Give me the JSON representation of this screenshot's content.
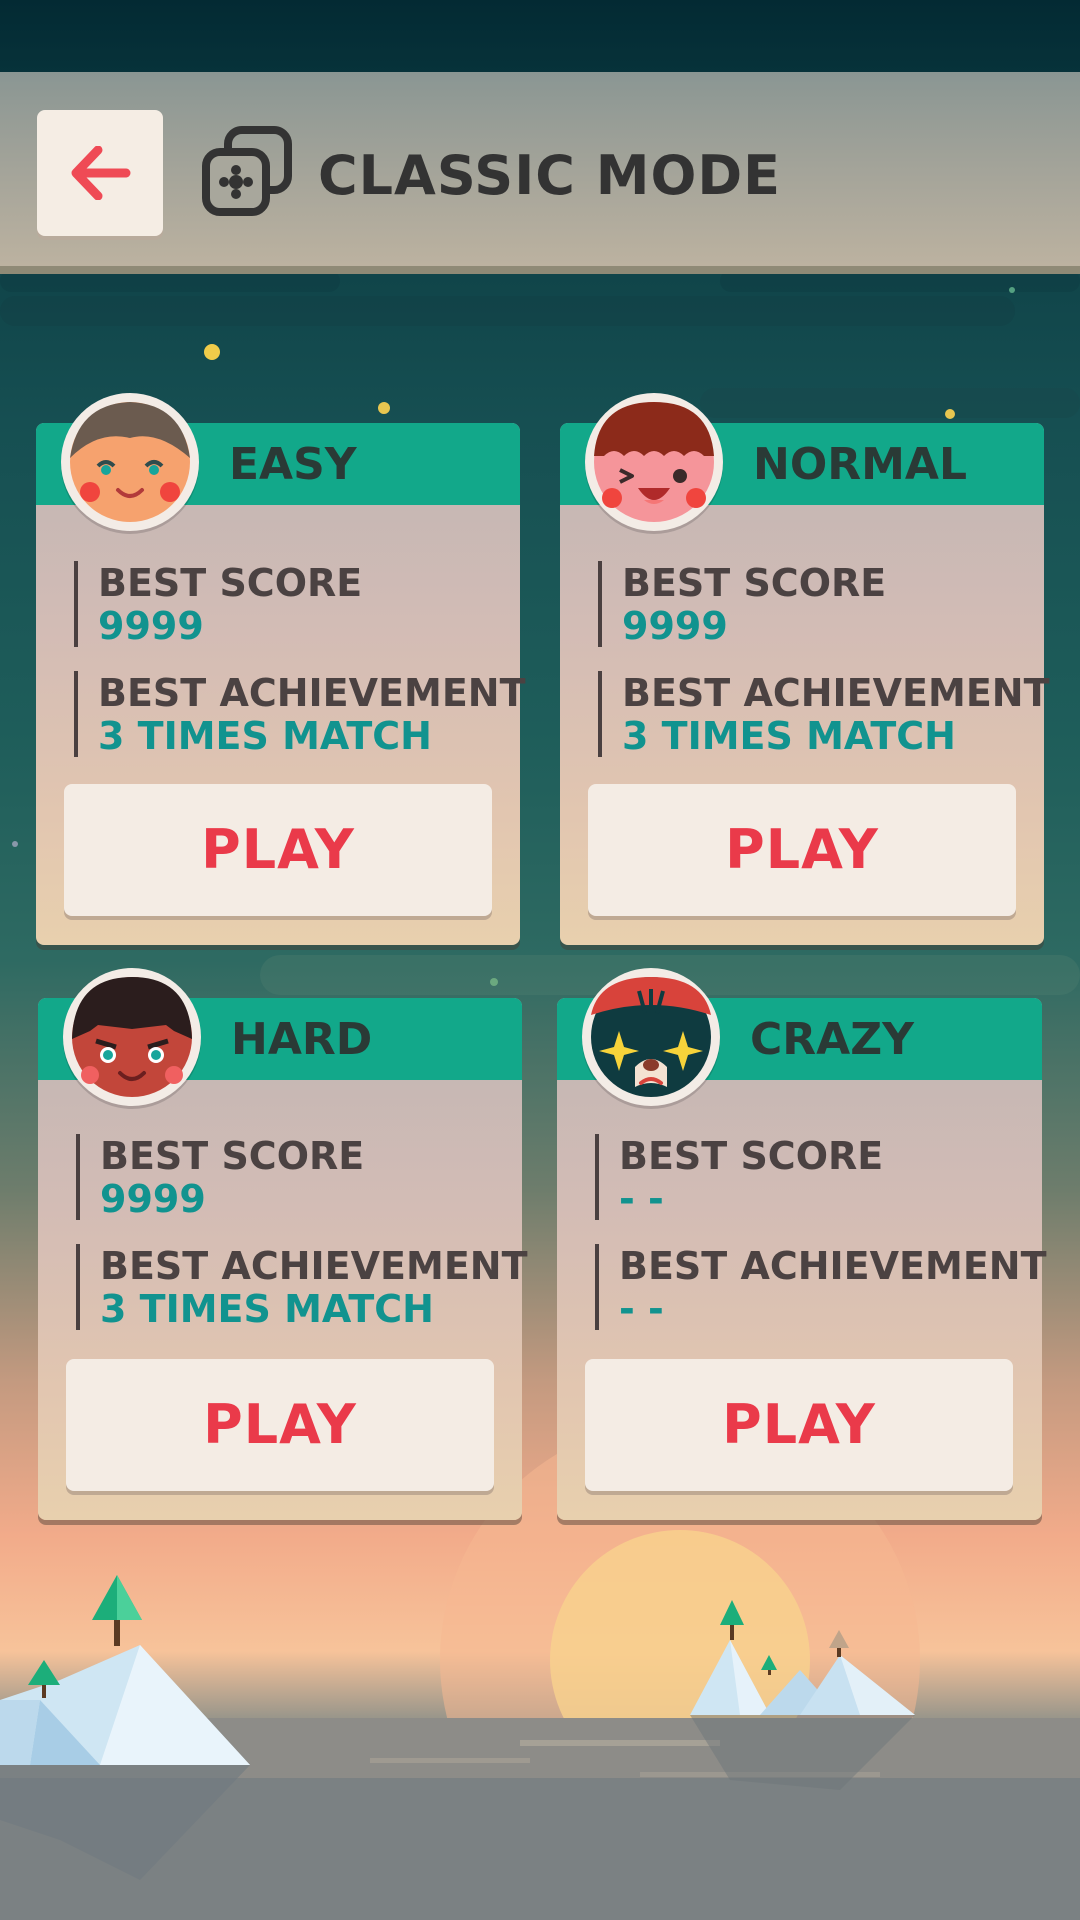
{
  "header": {
    "title": "CLASSIC MODE",
    "back_icon": "arrow-left-icon",
    "mode_icon": "cards-icon"
  },
  "colors": {
    "header_green": "#12a88a",
    "value_teal": "#11938f",
    "play_red": "#ea3a4a"
  },
  "cards": [
    {
      "name": "EASY",
      "avatar": "easy-face-icon",
      "best_score_label": "BEST SCORE",
      "best_score": "9999",
      "best_achievement_label": "BEST ACHIEVEMENT",
      "best_achievement": "3 TIMES MATCH",
      "play_label": "PLAY"
    },
    {
      "name": "NORMAL",
      "avatar": "normal-face-icon",
      "best_score_label": "BEST SCORE",
      "best_score": "9999",
      "best_achievement_label": "BEST ACHIEVEMENT",
      "best_achievement": "3 TIMES MATCH",
      "play_label": "PLAY"
    },
    {
      "name": "HARD",
      "avatar": "hard-face-icon",
      "best_score_label": "BEST SCORE",
      "best_score": "9999",
      "best_achievement_label": "BEST ACHIEVEMENT",
      "best_achievement": "3 TIMES MATCH",
      "play_label": "PLAY"
    },
    {
      "name": "CRAZY",
      "avatar": "crazy-cat-face-icon",
      "best_score_label": "BEST SCORE",
      "best_score": "- -",
      "best_achievement_label": "BEST ACHIEVEMENT",
      "best_achievement": "- -",
      "play_label": "PLAY"
    }
  ]
}
